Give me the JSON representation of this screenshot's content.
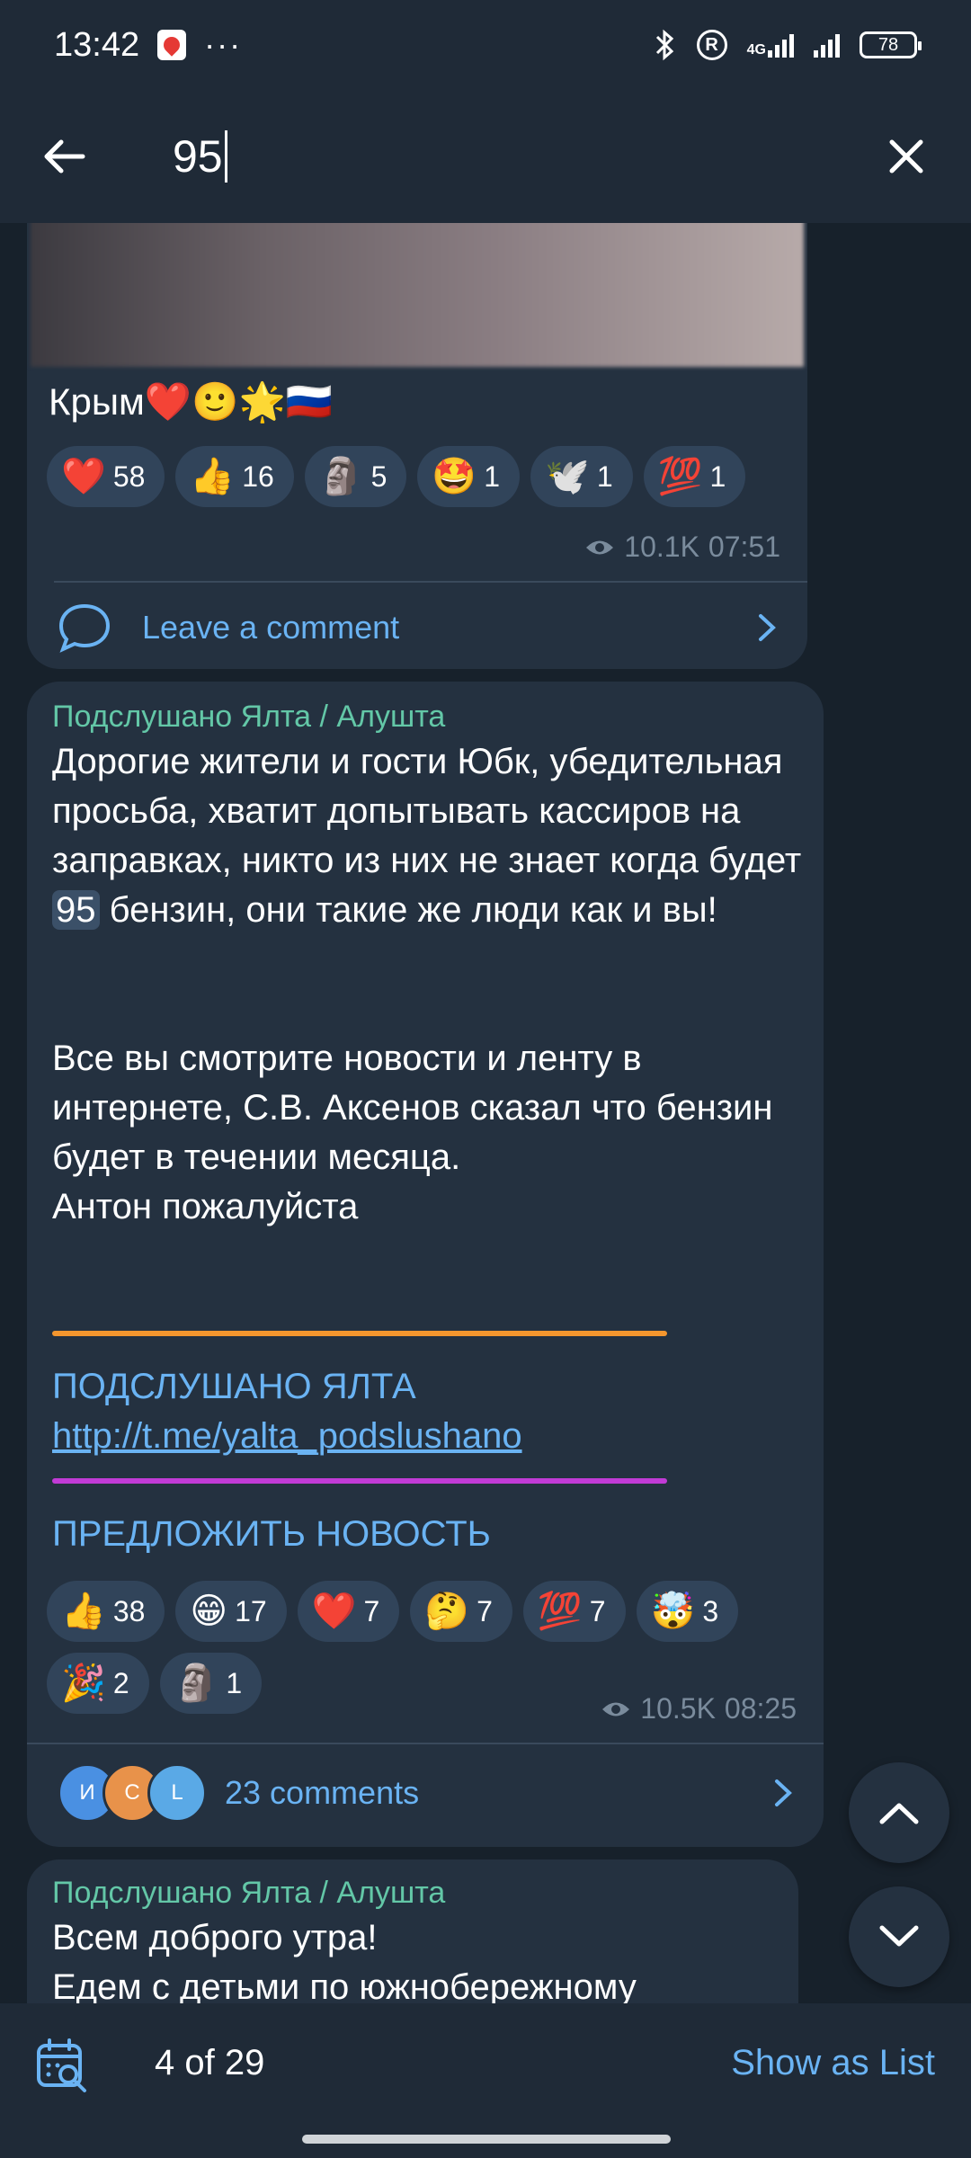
{
  "status_bar": {
    "time": "13:42",
    "dots": "···",
    "network": "4G",
    "r_label": "R",
    "battery": "78"
  },
  "search": {
    "query": "95"
  },
  "posts": [
    {
      "caption": "Крым❤️🙂🌟🇷🇺",
      "reactions": [
        {
          "emoji": "❤️",
          "count": "58"
        },
        {
          "emoji": "👍",
          "count": "16"
        },
        {
          "emoji": "🗿",
          "count": "5"
        },
        {
          "emoji": "🤩",
          "count": "1"
        },
        {
          "emoji": "🕊️",
          "count": "1"
        },
        {
          "emoji": "💯",
          "count": "1"
        }
      ],
      "views": "10.1K",
      "time": "07:51",
      "comment_label": "Leave a comment"
    },
    {
      "sender": "Подслушано Ялта / Алушта",
      "text_p1_before": "Дорогие жители и гости Юбк, убедительная просьба, хватит допытывать кассиров на заправках, никто из них не знает когда будет ",
      "text_highlight": "95",
      "text_p1_after": " бензин, они такие же люди как и вы!",
      "text_p2": "Все вы смотрите новости и ленту в интернете, С.В. Аксенов сказал что бензин будет в течении месяца.",
      "text_p3": "Антон пожалуйста",
      "channel_label": "ПОДСЛУШАНО ЯЛТА",
      "channel_link": "http://t.me/yalta_podslushano",
      "suggest_label": "ПРЕДЛОЖИТЬ НОВОСТЬ",
      "rule_colors": [
        "#f4962e",
        "#c13bd6"
      ],
      "reactions": [
        {
          "emoji": "👍",
          "count": "38"
        },
        {
          "emoji": "😁",
          "count": "17"
        },
        {
          "emoji": "❤️",
          "count": "7"
        },
        {
          "emoji": "🤔",
          "count": "7"
        },
        {
          "emoji": "💯",
          "count": "7"
        },
        {
          "emoji": "🤯",
          "count": "3"
        },
        {
          "emoji": "🎉",
          "count": "2"
        },
        {
          "emoji": "🗿",
          "count": "1"
        }
      ],
      "views": "10.5K",
      "time": "08:25",
      "avatars": [
        {
          "letter": "И",
          "color": "#4a90e2"
        },
        {
          "letter": "C",
          "color": "#e8924a"
        },
        {
          "letter": "L",
          "color": "#5aa9e6"
        }
      ],
      "comments_label": "23 comments"
    },
    {
      "sender": "Подслушано Ялта / Алушта",
      "line1": "Всем доброго утра!",
      "line2": "Едем с детьми по южнобережному"
    }
  ],
  "bottom_bar": {
    "counter": "4 of 29",
    "show_as_list": "Show as List"
  },
  "colors": {
    "accent": "#6ab3f3",
    "sender": "#63c7a7",
    "bubble": "#243140",
    "background": "#17212b",
    "header": "#1f2a37"
  }
}
